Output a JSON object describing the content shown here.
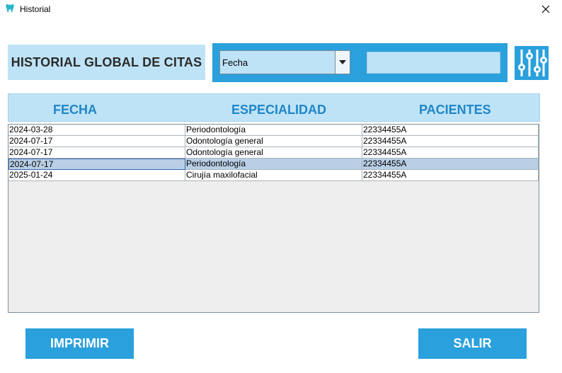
{
  "window": {
    "title": "Historial",
    "app_icon": "tooth-icon",
    "close_icon": "close-icon"
  },
  "heading": "HISTORIAL GLOBAL DE CITAS",
  "filter": {
    "selected": "Fecha",
    "search_value": "",
    "settings_icon": "sliders-icon"
  },
  "table": {
    "columns": [
      "FECHA",
      "ESPECIALIDAD",
      "PACIENTES"
    ],
    "rows": [
      [
        "2024-03-28",
        "Periodontología",
        "22334455A"
      ],
      [
        "2024-07-17",
        "Odontología general",
        "22334455A"
      ],
      [
        "2024-07-17",
        "Odontología general",
        "22334455A"
      ],
      [
        "2024-07-17",
        "Periodontología",
        "22334455A"
      ],
      [
        "2025-01-24",
        "Cirujía maxilofacial",
        "22334455A"
      ]
    ],
    "selected_row": 3
  },
  "buttons": {
    "print": "IMPRIMIR",
    "exit": "SALIR"
  },
  "colors": {
    "accent": "#2aa0dc",
    "light": "#bfe3f6",
    "header_text": "#1f86c8",
    "selection": "#b8cfe6"
  }
}
